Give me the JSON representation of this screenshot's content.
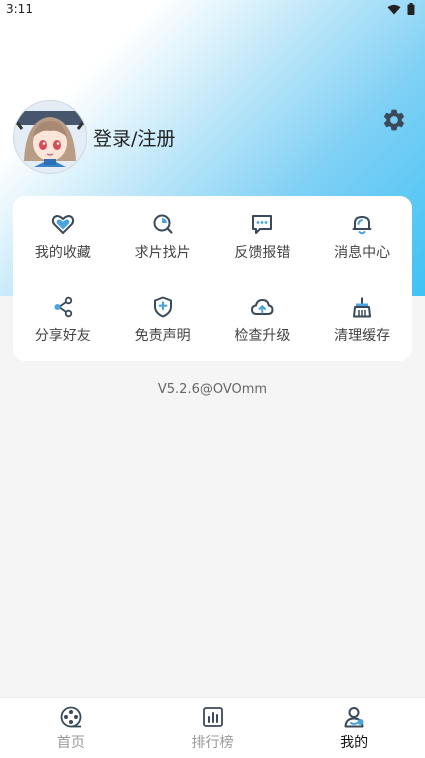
{
  "status_bar": {
    "time": "3:11",
    "icons": [
      "wifi-icon",
      "battery-icon"
    ]
  },
  "profile": {
    "login_label": "登录/注册",
    "avatar_icon": "avatar-anime-girl"
  },
  "menu": {
    "items": [
      {
        "label": "我的收藏",
        "icon": "heart-icon"
      },
      {
        "label": "求片找片",
        "icon": "search-film-icon"
      },
      {
        "label": "反馈报错",
        "icon": "feedback-icon"
      },
      {
        "label": "消息中心",
        "icon": "bell-icon"
      },
      {
        "label": "分享好友",
        "icon": "share-icon"
      },
      {
        "label": "免责声明",
        "icon": "shield-icon"
      },
      {
        "label": "检查升级",
        "icon": "cloud-upload-icon"
      },
      {
        "label": "清理缓存",
        "icon": "broom-icon"
      }
    ]
  },
  "version": "V5.2.6@OVOmm",
  "tabbar": {
    "tabs": [
      {
        "label": "首页",
        "icon": "film-reel-icon",
        "active": false
      },
      {
        "label": "排行榜",
        "icon": "bar-chart-icon",
        "active": false
      },
      {
        "label": "我的",
        "icon": "user-icon",
        "active": true
      }
    ]
  },
  "colors": {
    "accent": "#3fc2f5",
    "icon_blue": "#4aa3df",
    "icon_dark": "#3a4a5a",
    "active_tab": "#111111"
  }
}
